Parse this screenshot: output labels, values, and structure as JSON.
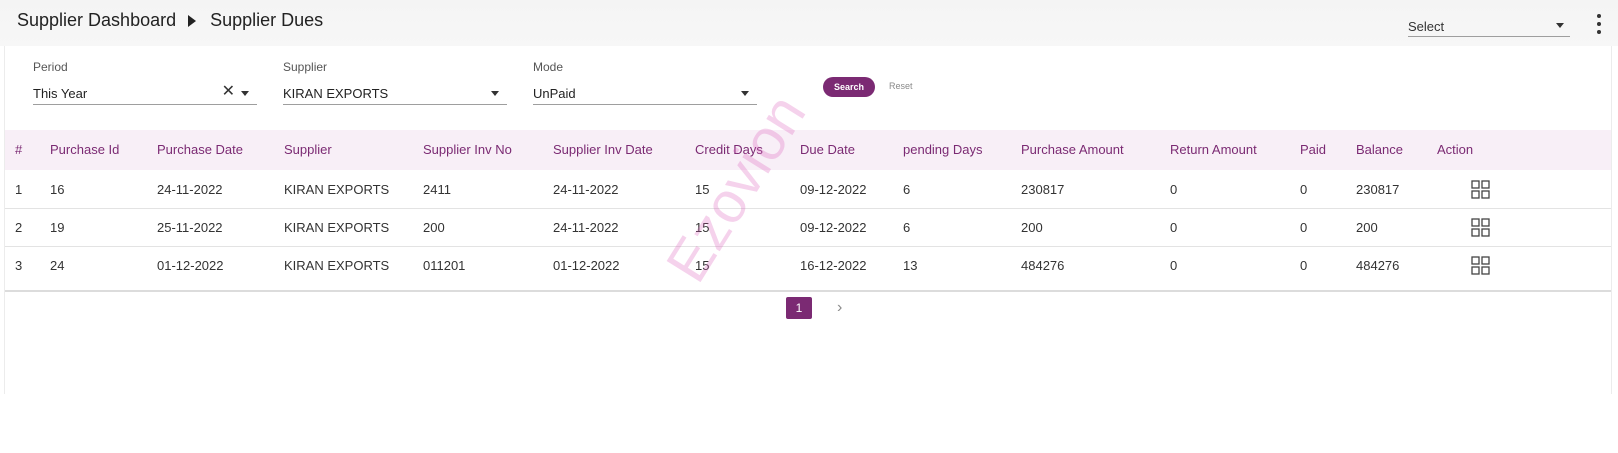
{
  "breadcrumb": {
    "parent": "Supplier Dashboard",
    "current": "Supplier Dues"
  },
  "top_select": {
    "value": "Select"
  },
  "filters": {
    "period": {
      "label": "Period",
      "value": "This Year"
    },
    "supplier": {
      "label": "Supplier",
      "value": "KIRAN EXPORTS"
    },
    "mode": {
      "label": "Mode",
      "value": "UnPaid"
    },
    "search_label": "Search",
    "reset_label": "Reset"
  },
  "table": {
    "columns": [
      "#",
      "Purchase Id",
      "Purchase Date",
      "Supplier",
      "Supplier Inv No",
      "Supplier Inv Date",
      "Credit Days",
      "Due Date",
      "pending Days",
      "Purchase Amount",
      "Return Amount",
      "Paid",
      "Balance",
      "Action"
    ],
    "rows": [
      [
        "1",
        "16",
        "24-11-2022",
        "KIRAN EXPORTS",
        "2411",
        "24-11-2022",
        "15",
        "09-12-2022",
        "6",
        "230817",
        "0",
        "0",
        "230817"
      ],
      [
        "2",
        "19",
        "25-11-2022",
        "KIRAN EXPORTS",
        "200",
        "24-11-2022",
        "15",
        "09-12-2022",
        "6",
        "200",
        "0",
        "0",
        "200"
      ],
      [
        "3",
        "24",
        "01-12-2022",
        "KIRAN EXPORTS",
        "011201",
        "01-12-2022",
        "15",
        "16-12-2022",
        "13",
        "484276",
        "0",
        "0",
        "484276"
      ]
    ]
  },
  "pagination": {
    "current_page": "1"
  },
  "watermark": "Ezovion",
  "colors": {
    "accent": "#7b2a73",
    "header_bg": "#f8eff7",
    "watermark": "#db5ebb"
  },
  "icons": {
    "action": "grid-view-icon",
    "next": "chevron-right-icon",
    "menu": "more-vertical-icon",
    "clear": "close-icon",
    "dropdown": "caret-down-icon",
    "separator": "caret-right-icon"
  }
}
